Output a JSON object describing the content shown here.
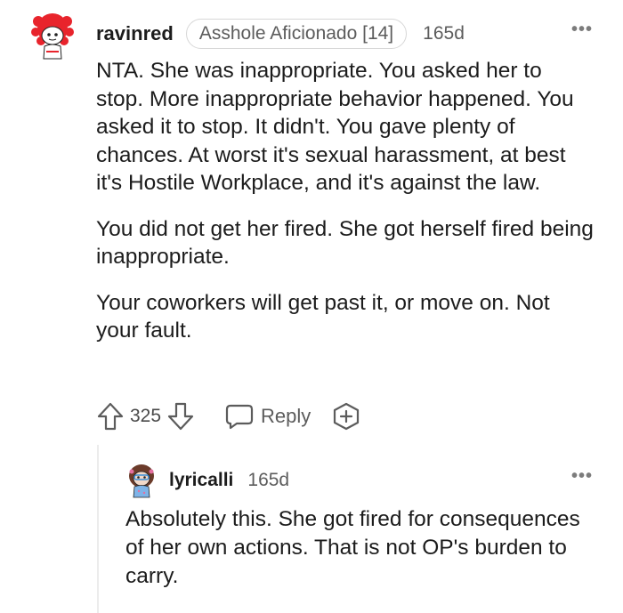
{
  "comment": {
    "username": "ravinred",
    "flair": "Asshole Aficionado [14]",
    "timestamp": "165d",
    "more_label": "•••",
    "paragraphs": [
      "NTA. She was inappropriate. You asked her to stop. More inappropriate behavior happened. You asked it to stop. It didn't. You gave plenty of chances. At worst it's sexual harassment, at best it's Hostile Workplace, and it's against the law.",
      "You did not get her fired. She got herself fired being inappropriate.",
      "Your coworkers will get past it, or move on. Not your fault."
    ],
    "actions": {
      "vote_count": "325",
      "reply_label": "Reply"
    }
  },
  "reply": {
    "username": "lyricalli",
    "timestamp": "165d",
    "more_label": "•••",
    "paragraphs": [
      "Absolutely this. She got fired for consequences of her own actions. That is not OP's burden to carry."
    ]
  },
  "colors": {
    "text": "#1c1c1c",
    "meta": "#5c5c5c",
    "flair_border": "#d7d7d7",
    "avatar_hair": "#e8242c",
    "thread_line": "#ececec"
  },
  "icons": {
    "upvote": "upvote-arrow-icon",
    "downvote": "downvote-arrow-icon",
    "reply": "speech-bubble-icon",
    "award": "award-plus-icon",
    "more": "more-dots-icon"
  }
}
